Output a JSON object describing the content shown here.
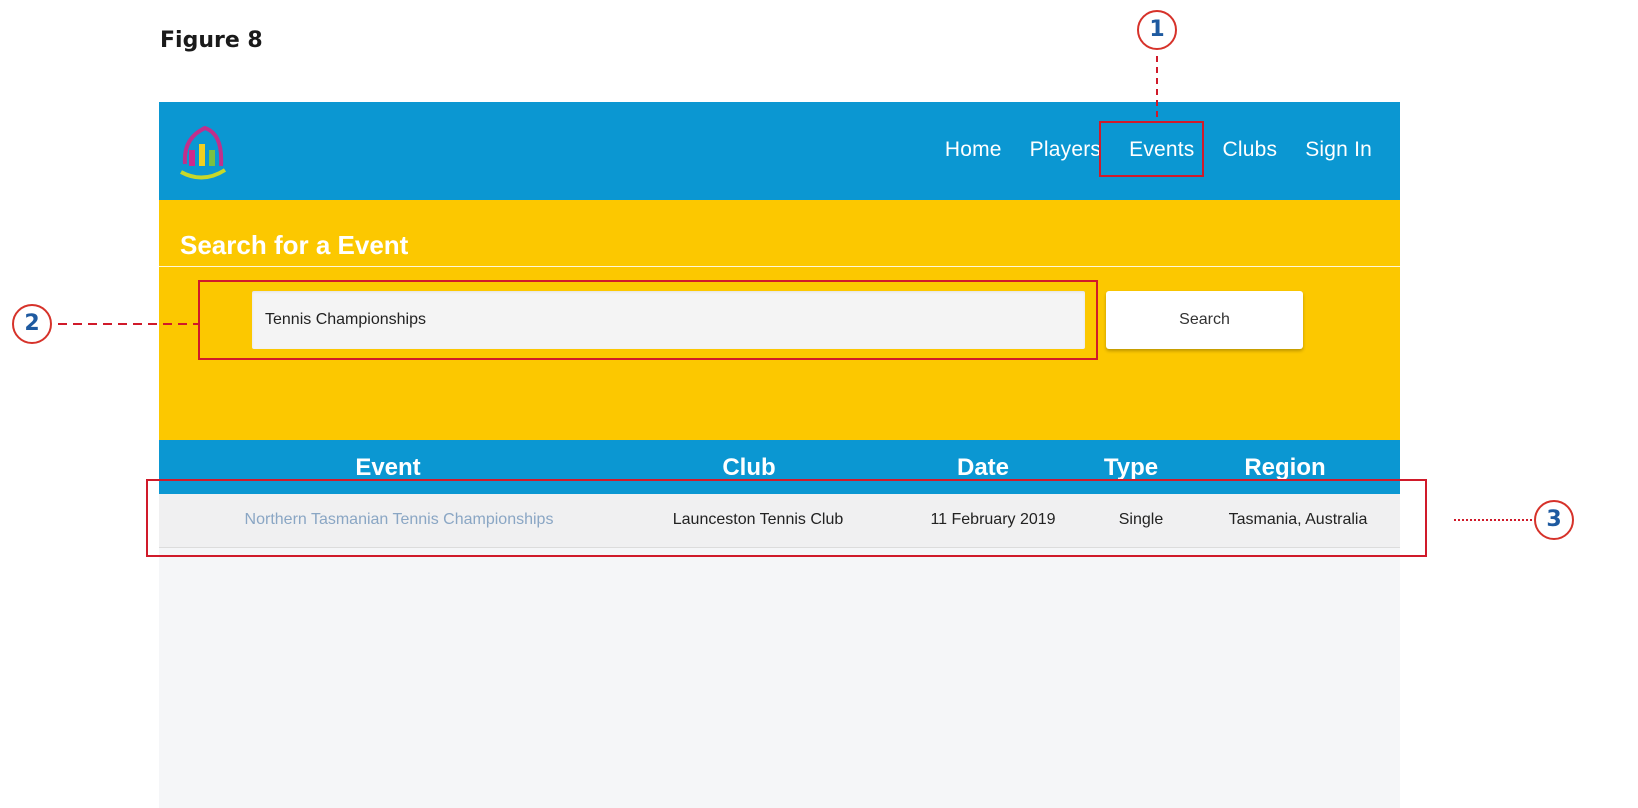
{
  "figure": {
    "title": "Figure 8"
  },
  "nav": {
    "items": [
      "Home",
      "Players",
      "Events",
      "Clubs",
      "Sign In"
    ]
  },
  "search": {
    "title": "Search for a Event",
    "value": "Tennis Championships",
    "button_label": "Search"
  },
  "table": {
    "columns": [
      "Event",
      "Club",
      "Date",
      "Type",
      "Region"
    ],
    "rows": [
      {
        "event": "Northern Tasmanian Tennis Championships",
        "club": "Launceston Tennis Club",
        "date": "11 February 2019",
        "type": "Single",
        "region": "Tasmania, Australia"
      }
    ]
  },
  "callouts": [
    "1",
    "2",
    "3"
  ],
  "colors": {
    "navbar": "#0b97d2",
    "search_panel": "#fcc800",
    "annotation": "#d01a2a",
    "callout_number": "#1e5aa0"
  }
}
